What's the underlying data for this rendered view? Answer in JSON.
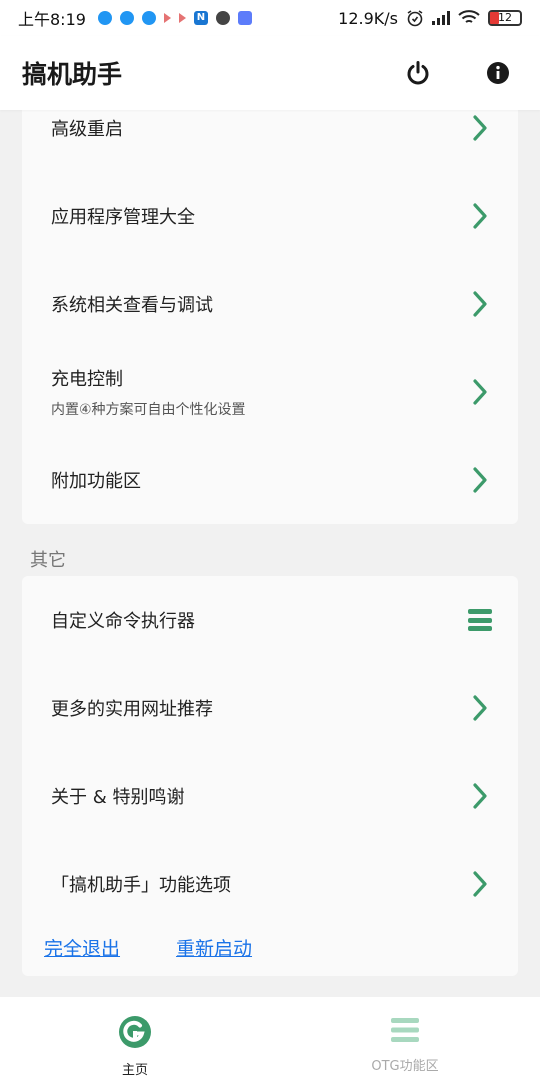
{
  "status_bar": {
    "time": "上午8:19",
    "net_speed": "12.9K/s",
    "battery": "12"
  },
  "app_bar": {
    "title": "搞机助手"
  },
  "card_top": {
    "rows": [
      {
        "label": "高级重启"
      },
      {
        "label": "应用程序管理大全"
      },
      {
        "label": "系统相关查看与调试"
      },
      {
        "label": "充电控制",
        "sub": "内置④种方案可自由个性化设置"
      },
      {
        "label": "附加功能区"
      }
    ]
  },
  "section_other": {
    "title": "其它",
    "rows": [
      {
        "label": "自定义命令执行器"
      },
      {
        "label": "更多的实用网址推荐"
      },
      {
        "label": "关于 & 特别鸣谢"
      },
      {
        "label": "「搞机助手」功能选项"
      }
    ],
    "links": {
      "exit": "完全退出",
      "restart": "重新启动"
    }
  },
  "bottom_nav": {
    "home": "主页",
    "otg": "OTG功能区"
  },
  "colors": {
    "accent": "#3c9a6a",
    "link": "#1a73e8"
  }
}
